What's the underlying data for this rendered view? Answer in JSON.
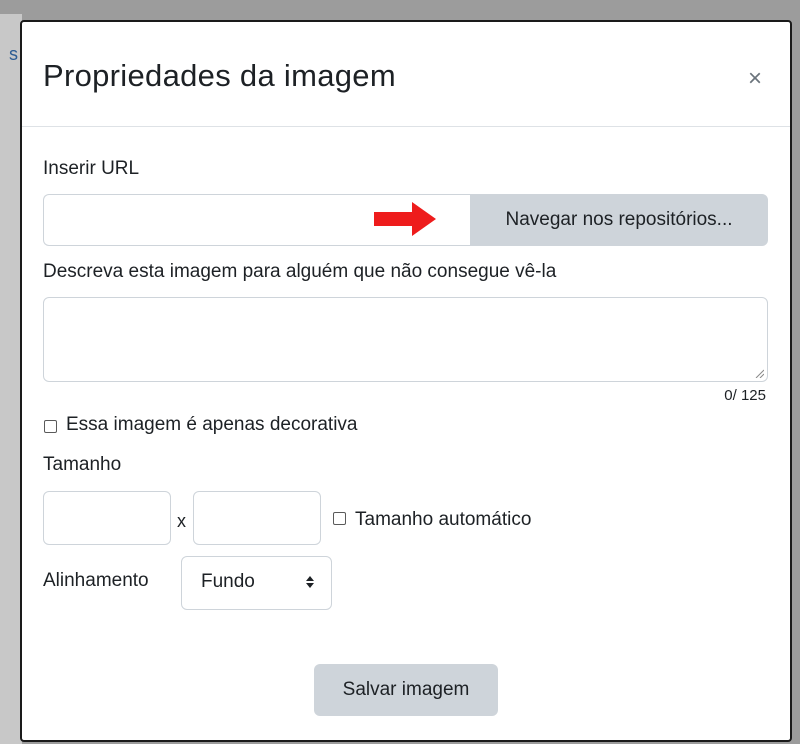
{
  "background": {
    "partial_text": "s"
  },
  "modal": {
    "title": "Propriedades da imagem",
    "close_label": "×"
  },
  "url_section": {
    "label": "Inserir URL",
    "input_value": "",
    "browse_button_label": "Navegar nos repositórios...",
    "arrow_color": "#ee1c1c"
  },
  "alt_section": {
    "label": "Descreva esta imagem para alguém que não consegue vê-la",
    "textarea_value": "",
    "counter": "0/ 125"
  },
  "decorative": {
    "label": "Essa imagem é apenas decorativa",
    "checked": false
  },
  "size_section": {
    "label": "Tamanho",
    "width_value": "",
    "height_value": "",
    "separator": "x",
    "auto_label": "Tamanho automático",
    "auto_checked": false
  },
  "alignment": {
    "label": "Alinhamento",
    "selected": "Fundo"
  },
  "save_button_label": "Salvar imagem",
  "colors": {
    "button_bg": "#ced4da",
    "border": "#ced4da",
    "text": "#1d2125"
  }
}
